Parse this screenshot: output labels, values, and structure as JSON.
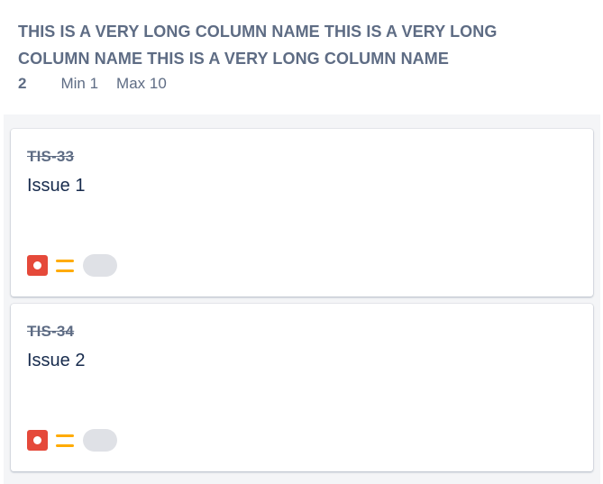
{
  "column": {
    "title": "This is a very long column name this is a very long column name this is a very long column name",
    "issue_count": "2",
    "min_label": "Min 1",
    "max_label": "Max 10"
  },
  "cards": [
    {
      "key": "TIS-33",
      "summary": "Issue 1",
      "type_icon": "bug-icon",
      "priority_icon": "priority-medium-icon",
      "type_color": "#e5493a",
      "priority_color": "#ffab00"
    },
    {
      "key": "TIS-34",
      "summary": "Issue 2",
      "type_icon": "bug-icon",
      "priority_icon": "priority-medium-icon",
      "type_color": "#e5493a",
      "priority_color": "#ffab00"
    }
  ]
}
